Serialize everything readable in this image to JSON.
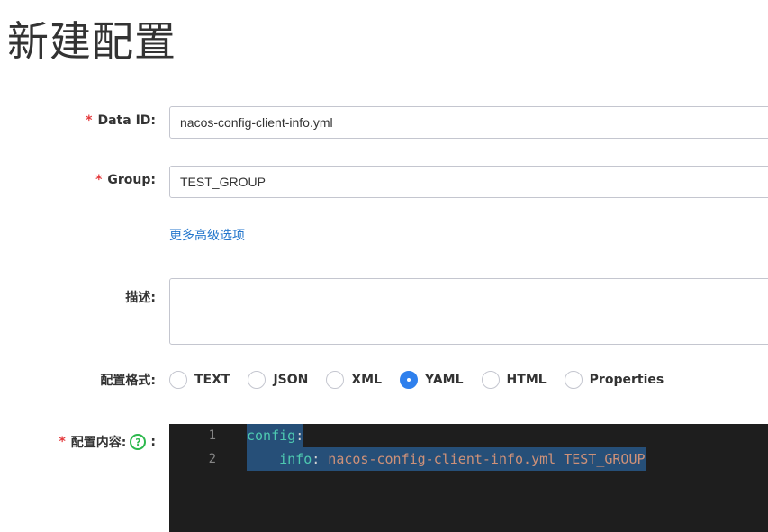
{
  "page": {
    "title": "新建配置"
  },
  "form": {
    "data_id": {
      "required_mark": "*",
      "label": "Data ID:",
      "value": "nacos-config-client-info.yml"
    },
    "group": {
      "required_mark": "*",
      "label": "Group:",
      "value": "TEST_GROUP"
    },
    "advanced_link": "更多高级选项",
    "description": {
      "label": "描述:",
      "value": ""
    },
    "format": {
      "label": "配置格式:",
      "options": [
        "TEXT",
        "JSON",
        "XML",
        "YAML",
        "HTML",
        "Properties"
      ],
      "selected": "YAML"
    },
    "content": {
      "required_mark": "*",
      "label": "配置内容:",
      "help_glyph": "?",
      "suffix": ":",
      "lines": [
        {
          "number": "1",
          "key": "config",
          "colon": ":",
          "value": ""
        },
        {
          "number": "2",
          "indent": "    ",
          "key": "info",
          "colon": ":",
          "value": " nacos-config-client-info.yml TEST_GROUP"
        }
      ]
    }
  },
  "colors": {
    "required": "#e4393c",
    "link": "#2376cc",
    "radio_selected": "#2f80ed",
    "help_icon": "#2db84d",
    "editor_bg": "#1e1e1e",
    "selection": "#264f78"
  },
  "icons": {
    "help": "question-circle-icon"
  }
}
